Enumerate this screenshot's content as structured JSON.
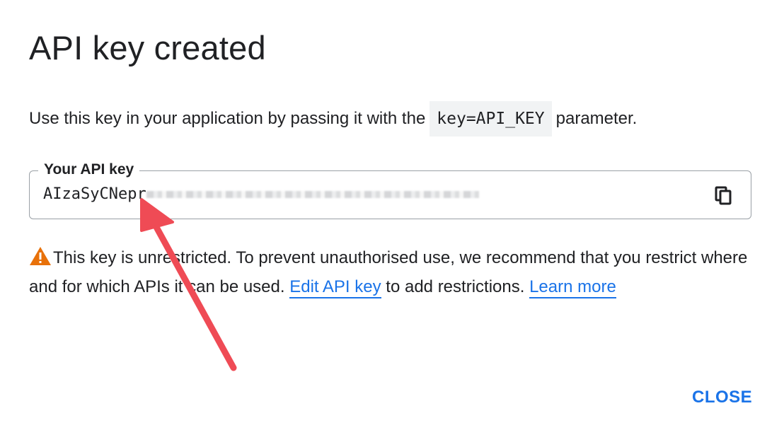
{
  "dialog": {
    "title": "API key created",
    "description_before": "Use this key in your application by passing it with the",
    "description_code": "key=API_KEY",
    "description_after": "parameter.",
    "field": {
      "label": "Your API key",
      "value_visible": "AIzaSyCNepr",
      "copy_icon": "copy-icon"
    },
    "warning": {
      "icon": "warning-triangle-icon",
      "text_before": "This key is unrestricted. To prevent unauthorised use, we recommend that you restrict where and for which APIs it can be used.",
      "edit_link": "Edit API key",
      "text_middle": "to add restrictions.",
      "learn_link": "Learn more"
    },
    "close_label": "CLOSE"
  },
  "colors": {
    "accent": "#1a73e8",
    "warning": "#e8710a",
    "annotation_arrow": "#ef4b55"
  }
}
